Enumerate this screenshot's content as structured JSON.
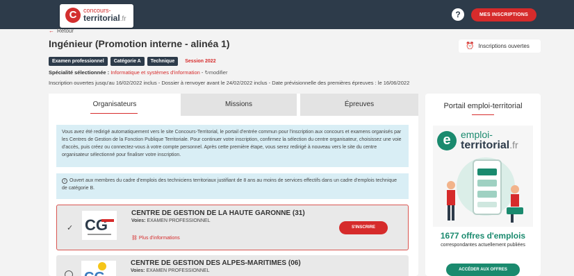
{
  "header": {
    "logo": {
      "line1": "concours-",
      "line2": "territorial",
      "suffix": ".fr"
    },
    "help_label": "?",
    "mes_inscriptions": "MES INSCRIPTIONS"
  },
  "retour": "Retour",
  "page_title": "Ingénieur (Promotion interne - alinéa 1)",
  "inscriptions_ouvertes": "Inscriptions ouvertes",
  "tags": [
    "Examen professionnel",
    "Catégorie A",
    "Technique"
  ],
  "session": "Session 2022",
  "specialite": {
    "label": "Spécialité sélectionnée :",
    "value": "Informatique et systèmes d'information",
    "sep": " - ",
    "modifier": "modifier"
  },
  "dates_text": "Inscription ouvertes jusqu'au 16/02/2022 inclus - Dossier à renvoyer avant le 24/02/2022 inclus - Date prévisionnelle des premières épreuves : le 16/06/2022",
  "tabs": [
    {
      "label": "Organisateurs",
      "active": true
    },
    {
      "label": "Missions",
      "active": false
    },
    {
      "label": "Épreuves",
      "active": false
    }
  ],
  "info_redirect": "Vous avez été redirigé automatiquement vers le site Concours-Territorial, le portail d'entrée commun pour l'inscription aux concours et examens organisés par les Centres de Gestion de la Fonction Publique Territoriale. Pour continuer votre inscription, confirmez la sélection du centre organisateur, choisissez une voie d'accès, puis créez ou connectez-vous à votre compte personnel. Après cette première étape, vous serez redirigé à nouveau vers le site du centre organisateur sélectionné pour finaliser votre inscription.",
  "info_eligibility": "Ouvert aux membres du cadre d'emplois des techniciens territoriaux justifiant de 8 ans au moins de services effectifs dans un cadre d'emplois technique de catégorie B.",
  "organisateurs": [
    {
      "name": "CENTRE DE GESTION DE LA HAUTE GARONNE (31)",
      "voies_label": "Voies:",
      "voies_value": "EXAMEN PROFESSIONNEL",
      "plus_info": "Plus d'informations",
      "button": "S'INSCRIRE",
      "selected": true
    },
    {
      "name": "CENTRE DE GESTION DES ALPES-MARITIMES (06)",
      "voies_label": "Voies:",
      "voies_value": "EXAMEN PROFESSIONNEL",
      "selected": false
    }
  ],
  "sidebar": {
    "title": "Portail emploi-territorial",
    "promo_logo": {
      "line1": "emploi-",
      "line2": "territorial",
      "suffix": ".fr"
    },
    "offres": "1677 offres d'emplois",
    "correspondantes": "correspondantes actuellement publiées",
    "acceder": "ACCÉDER AUX OFFRES"
  },
  "colors": {
    "navy": "#2d3b4a",
    "accent_red": "#d62b2b",
    "green": "#1a8a6e",
    "info_bg": "#d9eef5"
  }
}
